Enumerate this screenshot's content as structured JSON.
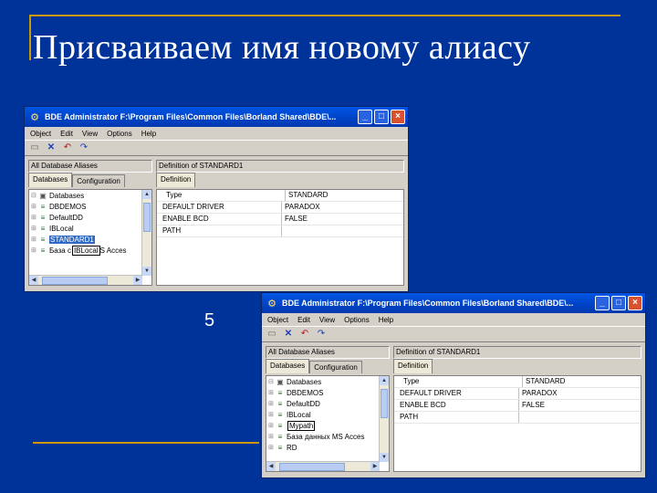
{
  "slide": {
    "title": "Присваиваем имя новому алиасу",
    "page_number": "5"
  },
  "window": {
    "title": "BDE Administrator  F:\\Program Files\\Common Files\\Borland Shared\\BDE\\...",
    "buttons": {
      "minimize": "_",
      "maximize": "□",
      "close": "×"
    },
    "menu": [
      "Object",
      "Edit",
      "View",
      "Options",
      "Help"
    ],
    "left_caption": "All Database Aliases",
    "tabs": [
      "Databases",
      "Configuration"
    ],
    "right_caption": "Definition of STANDARD1",
    "right_tab": "Definition",
    "definition_rows": [
      {
        "key": "Type",
        "value": "STANDARD"
      },
      {
        "key": "DEFAULT DRIVER",
        "value": "PARADOX"
      },
      {
        "key": "ENABLE BCD",
        "value": "FALSE"
      },
      {
        "key": "PATH",
        "value": ""
      }
    ]
  },
  "window1": {
    "tree": [
      {
        "label": "Databases",
        "icon": "databases-icon"
      },
      {
        "label": "DBDEMOS",
        "icon": "database-icon"
      },
      {
        "label": "DefaultDD",
        "icon": "database-icon"
      },
      {
        "label": "IBLocal",
        "icon": "database-icon"
      },
      {
        "label": "STANDARD1",
        "icon": "database-icon",
        "selected": true
      },
      {
        "label": "База с",
        "edit_text": "IBLocal",
        "suffix": "S Acces",
        "icon": "database-icon"
      }
    ]
  },
  "window2": {
    "tree": [
      {
        "label": "Databases",
        "icon": "databases-icon"
      },
      {
        "label": "DBDEMOS",
        "icon": "database-icon"
      },
      {
        "label": "DefaultDD",
        "icon": "database-icon"
      },
      {
        "label": "IBLocal",
        "icon": "database-icon"
      },
      {
        "label": "",
        "edit_text": "Mypath",
        "icon": "database-icon"
      },
      {
        "label": "База данных MS Acces",
        "icon": "database-icon"
      }
    ],
    "extra_row": "RD"
  }
}
